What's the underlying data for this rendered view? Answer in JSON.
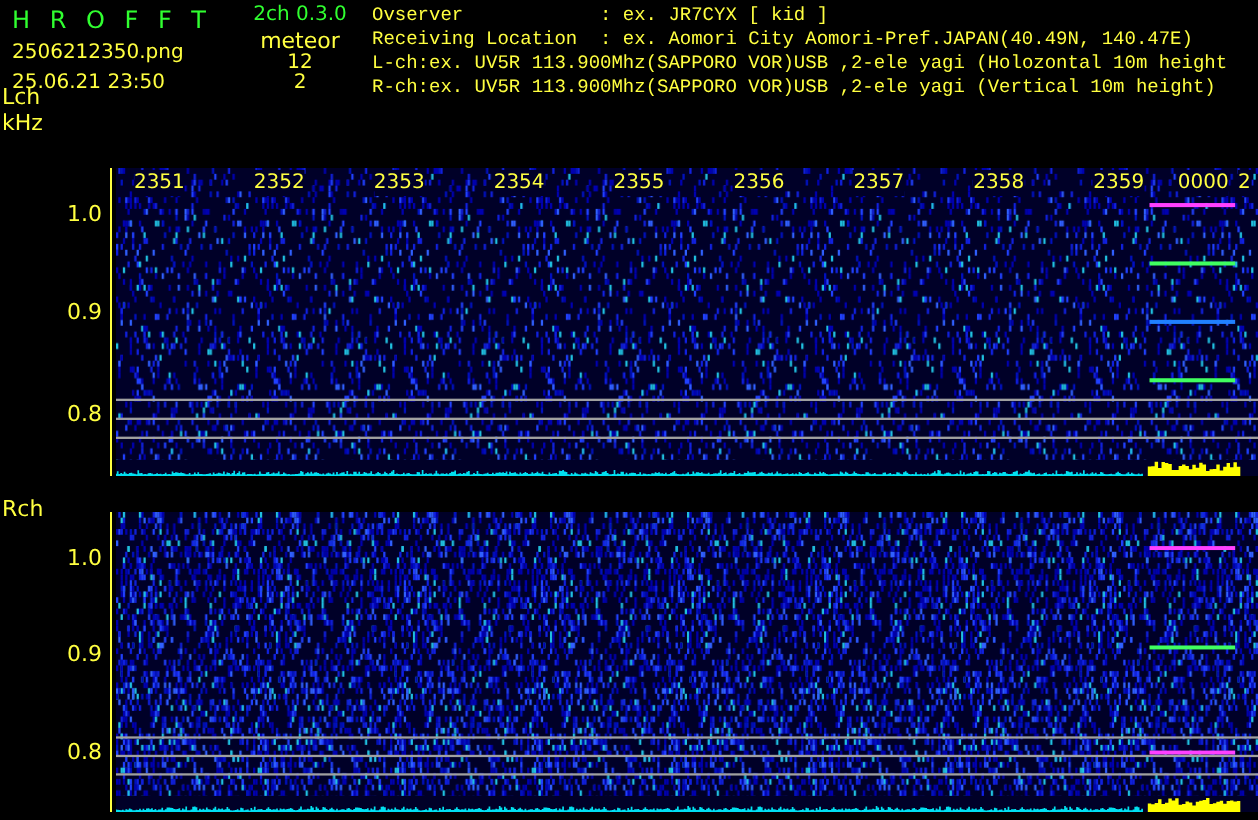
{
  "header": {
    "app_title": "H R O F F T",
    "version": "2ch 0.3.0",
    "filename": "2506212350.png",
    "datetime": "25.06.21 23:50",
    "meteor_label": "meteor",
    "meteor_counts": [
      "12",
      "2"
    ],
    "info": [
      {
        "label": "Ovserver",
        "value": ": ex. JR7CYX [ kid ]"
      },
      {
        "label": "Receiving Location",
        "value": ": ex. Aomori City Aomori-Pref.JAPAN(40.49N, 140.47E)"
      }
    ],
    "channel_lines": [
      "L-ch:ex. UV5R 113.900Mhz(SAPPORO VOR)USB ,2-ele yagi (Holozontal 10m height",
      "R-ch:ex. UV5R 113.900Mhz(SAPPORO VOR)USB ,2-ele yagi (Vertical 10m height)"
    ]
  },
  "time_labels": [
    "2351",
    "2352",
    "2353",
    "2354",
    "2355",
    "2356",
    "2357",
    "2358",
    "2359",
    "0000",
    "2"
  ],
  "channels": [
    {
      "label": "Lch",
      "unit": "kHz",
      "yticks": [
        "1.0",
        "0.9",
        "0.8"
      ]
    },
    {
      "label": "Rch",
      "yticks": [
        "1.0",
        "0.9",
        "0.8"
      ]
    }
  ]
}
